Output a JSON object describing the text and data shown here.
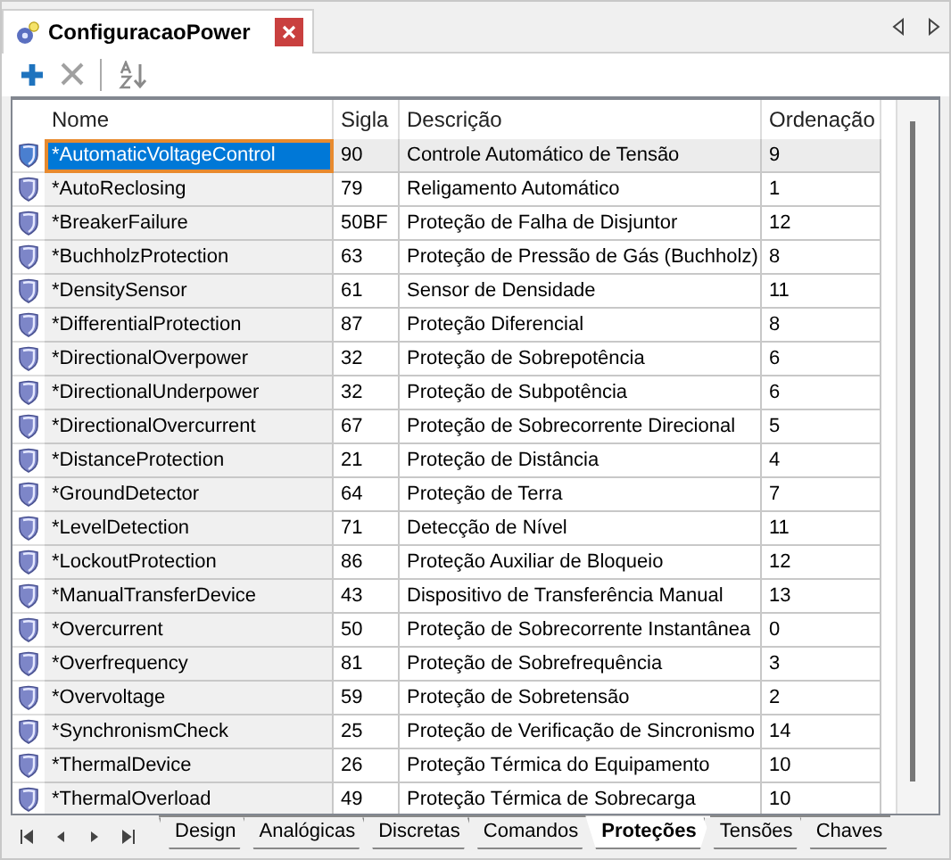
{
  "document_tab": {
    "title": "ConfiguracaoPower"
  },
  "columns": [
    "Nome",
    "Sigla",
    "Descrição",
    "Ordenação"
  ],
  "rows": [
    {
      "name": "*AutomaticVoltageControl",
      "sigla": "90",
      "descricao": "Controle Automático de Tensão",
      "ordenacao": "9",
      "selected": true
    },
    {
      "name": "*AutoReclosing",
      "sigla": "79",
      "descricao": "Religamento Automático",
      "ordenacao": "1",
      "selected": false
    },
    {
      "name": "*BreakerFailure",
      "sigla": "50BF",
      "descricao": "Proteção de Falha de Disjuntor",
      "ordenacao": "12",
      "selected": false
    },
    {
      "name": "*BuchholzProtection",
      "sigla": "63",
      "descricao": "Proteção de Pressão de Gás (Buchholz)",
      "ordenacao": "8",
      "selected": false
    },
    {
      "name": "*DensitySensor",
      "sigla": "61",
      "descricao": "Sensor de Densidade",
      "ordenacao": "11",
      "selected": false
    },
    {
      "name": "*DifferentialProtection",
      "sigla": "87",
      "descricao": "Proteção Diferencial",
      "ordenacao": "8",
      "selected": false
    },
    {
      "name": "*DirectionalOverpower",
      "sigla": "32",
      "descricao": "Proteção de Sobrepotência",
      "ordenacao": "6",
      "selected": false
    },
    {
      "name": "*DirectionalUnderpower",
      "sigla": "32",
      "descricao": "Proteção de Subpotência",
      "ordenacao": "6",
      "selected": false
    },
    {
      "name": "*DirectionalOvercurrent",
      "sigla": "67",
      "descricao": "Proteção de Sobrecorrente Direcional",
      "ordenacao": "5",
      "selected": false
    },
    {
      "name": "*DistanceProtection",
      "sigla": "21",
      "descricao": "Proteção de Distância",
      "ordenacao": "4",
      "selected": false
    },
    {
      "name": "*GroundDetector",
      "sigla": "64",
      "descricao": "Proteção de Terra",
      "ordenacao": "7",
      "selected": false
    },
    {
      "name": "*LevelDetection",
      "sigla": "71",
      "descricao": "Detecção de Nível",
      "ordenacao": "11",
      "selected": false
    },
    {
      "name": "*LockoutProtection",
      "sigla": "86",
      "descricao": "Proteção Auxiliar de Bloqueio",
      "ordenacao": "12",
      "selected": false
    },
    {
      "name": "*ManualTransferDevice",
      "sigla": "43",
      "descricao": "Dispositivo de Transferência Manual",
      "ordenacao": "13",
      "selected": false
    },
    {
      "name": "*Overcurrent",
      "sigla": "50",
      "descricao": "Proteção de Sobrecorrente Instantânea",
      "ordenacao": "0",
      "selected": false
    },
    {
      "name": "*Overfrequency",
      "sigla": "81",
      "descricao": "Proteção de Sobrefrequência",
      "ordenacao": "3",
      "selected": false
    },
    {
      "name": "*Overvoltage",
      "sigla": "59",
      "descricao": "Proteção de Sobretensão",
      "ordenacao": "2",
      "selected": false
    },
    {
      "name": "*SynchronismCheck",
      "sigla": "25",
      "descricao": "Proteção de Verificação de Sincronismo",
      "ordenacao": "14",
      "selected": false
    },
    {
      "name": "*ThermalDevice",
      "sigla": "26",
      "descricao": "Proteção Térmica do Equipamento",
      "ordenacao": "10",
      "selected": false
    },
    {
      "name": "*ThermalOverload",
      "sigla": "49",
      "descricao": "Proteção Térmica de Sobrecarga",
      "ordenacao": "10",
      "selected": false
    }
  ],
  "sheet_tabs": [
    {
      "label": "Design",
      "selected": false
    },
    {
      "label": "Analógicas",
      "selected": false
    },
    {
      "label": "Discretas",
      "selected": false
    },
    {
      "label": "Comandos",
      "selected": false
    },
    {
      "label": "Proteções",
      "selected": true
    },
    {
      "label": "Tensões",
      "selected": false
    },
    {
      "label": "Chaves",
      "selected": false
    }
  ]
}
